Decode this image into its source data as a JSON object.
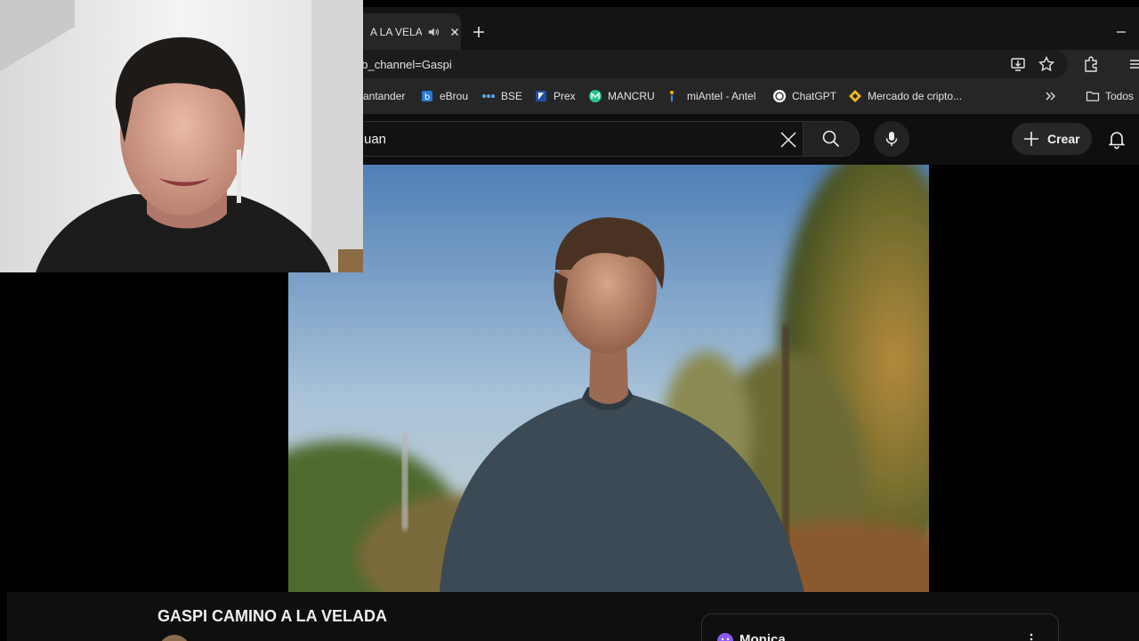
{
  "browser": {
    "tab_title": "A LA VELADA",
    "address_text": "ab_channel=Gaspi",
    "bookmarks": [
      {
        "label": "antander",
        "icon": "santander-icon"
      },
      {
        "label": "eBrou",
        "icon": "ebrou-icon"
      },
      {
        "label": "BSE",
        "icon": "bse-icon"
      },
      {
        "label": "Prex",
        "icon": "prex-icon"
      },
      {
        "label": "MANCRU",
        "icon": "mancru-icon"
      },
      {
        "label": "miAntel - Antel",
        "icon": "antel-icon"
      },
      {
        "label": "ChatGPT",
        "icon": "chatgpt-icon"
      },
      {
        "label": "Mercado de cripto...",
        "icon": "binance-icon"
      }
    ],
    "all_bookmarks_label": "Todos"
  },
  "youtube": {
    "search_value": "uan",
    "create_label": "Crear",
    "video_title": "GASPI CAMINO A LA VELADA",
    "chat_user": "Monica"
  },
  "colors": {
    "chrome_dark": "#262626",
    "youtube_bg": "#0f0f0f",
    "text": "#f1f1f1"
  }
}
